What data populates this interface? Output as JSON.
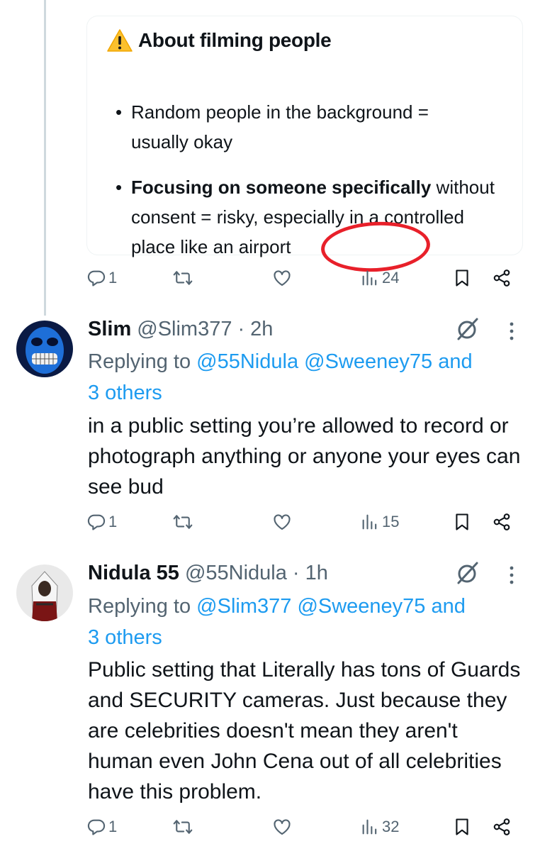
{
  "card": {
    "title": "About filming people",
    "bullets": [
      {
        "bold": "",
        "text": "Random people in the background = usually okay"
      },
      {
        "bold": "Focusing on someone specifically",
        "text": " without consent = risky, especially in a controlled place like an airport"
      }
    ]
  },
  "tweets": [
    {
      "actions": {
        "replies": "1",
        "views": "24"
      }
    },
    {
      "name": "Slim",
      "handle": "@Slim377",
      "time": "· 2h",
      "replying_prefix": "Replying to ",
      "mentions": [
        "@55Nidula",
        "@Sweeney75"
      ],
      "and": " and",
      "others": "3 others",
      "body": "in a public setting you’re allowed to record or photograph anything or anyone your eyes can see bud",
      "actions": {
        "replies": "1",
        "views": "15"
      }
    },
    {
      "name": "Nidula 55",
      "handle": "@55Nidula",
      "time": "· 1h",
      "replying_prefix": "Replying to ",
      "mentions": [
        "@Slim377",
        "@Sweeney75"
      ],
      "and": " and",
      "others": "3 others",
      "body": "Public setting that Literally has tons of Guards and SECURITY cameras. Just because they are celebrities doesn't mean they aren't human even John Cena out of all celebrities have this problem.",
      "actions": {
        "replies": "1",
        "views": "32"
      }
    }
  ],
  "icons": {
    "warning": "warning-icon",
    "reply": "reply-icon",
    "retweet": "retweet-icon",
    "like": "heart-icon",
    "views": "views-icon",
    "bookmark": "bookmark-icon",
    "share": "share-icon",
    "grok": "grok-icon",
    "more": "more-icon"
  },
  "colors": {
    "accent": "#1d9bf0",
    "secondary_text": "#536471",
    "annotation": "#e8202a"
  }
}
